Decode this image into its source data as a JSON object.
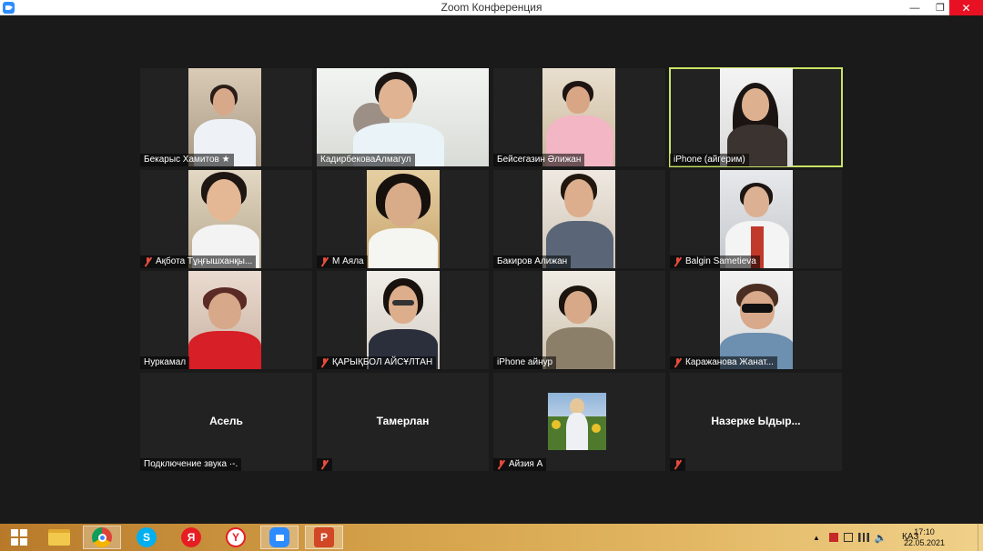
{
  "window": {
    "title": "Zoom Конференция",
    "minimize_glyph": "—",
    "maximize_glyph": "❐",
    "close_glyph": "✕"
  },
  "participants": [
    {
      "name": "Бекарыс Хамитов ★",
      "muted": false,
      "has_video": true,
      "active": false
    },
    {
      "name": "КадирбековаАлмагул",
      "muted": false,
      "has_video": true,
      "active": false
    },
    {
      "name": "Бейсегазин Әлижан",
      "muted": false,
      "has_video": true,
      "active": false
    },
    {
      "name": "iPhone (айгерим)",
      "muted": false,
      "has_video": true,
      "active": true
    },
    {
      "name": "Ақбота Тұңғышханқы...",
      "muted": true,
      "has_video": true,
      "active": false
    },
    {
      "name": "М Аяла",
      "muted": true,
      "has_video": true,
      "active": false
    },
    {
      "name": "Бакиров Алижан",
      "muted": false,
      "has_video": true,
      "active": false
    },
    {
      "name": "Balgin Sametieva",
      "muted": true,
      "has_video": true,
      "active": false
    },
    {
      "name": "Нуркамал",
      "muted": false,
      "has_video": true,
      "active": false
    },
    {
      "name": "ҚАРЫҚБОЛ АЙСҰЛТАН",
      "muted": true,
      "has_video": true,
      "active": false
    },
    {
      "name": "iPhone айнур",
      "muted": false,
      "has_video": true,
      "active": false
    },
    {
      "name": "Каражанова Жанат...",
      "muted": true,
      "has_video": true,
      "active": false
    },
    {
      "name": "Асель",
      "muted": false,
      "has_video": false,
      "status": "Подключение звука ·-.",
      "active": false
    },
    {
      "name": "Тамерлан",
      "muted": true,
      "has_video": false,
      "active": false
    },
    {
      "name": "Айзия А",
      "muted": true,
      "has_video": false,
      "has_photo": true,
      "active": false
    },
    {
      "name": "Назерке Ыдыр...",
      "muted": true,
      "has_video": false,
      "active": false
    }
  ],
  "taskbar": {
    "apps": [
      "windows-start",
      "file-explorer",
      "chrome",
      "skype",
      "yandex",
      "yandex-browser",
      "zoom",
      "powerpoint"
    ],
    "language": "ҚАЗ",
    "time": "17:10",
    "date": "22.05.2021",
    "skype_glyph": "S",
    "yandex_glyph": "Я",
    "yandex_browser_glyph": "Y",
    "powerpoint_glyph": "P"
  }
}
